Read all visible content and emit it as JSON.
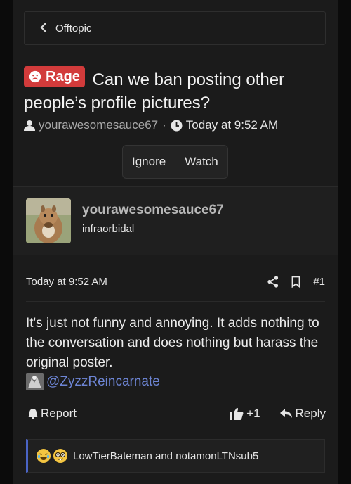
{
  "breadcrumb": {
    "label": "Offtopic"
  },
  "thread": {
    "prefix": "Rage",
    "title": "Can we ban posting other people’s profile pictures?",
    "author": "yourawesomesauce67",
    "separator": "·",
    "time": "Today at 9:52 AM"
  },
  "thread_actions": {
    "ignore": "Ignore",
    "watch": "Watch"
  },
  "post": {
    "username": "yourawesomesauce67",
    "user_title": "infraorbidal",
    "time": "Today at 9:52 AM",
    "number": "#1",
    "body": "It's just not funny and annoying. It adds nothing to the conversation and does nothing but harass the original poster.",
    "mention": "@ZyzzReincarnate",
    "report": "Report",
    "like_count": "+1",
    "reply": "Reply",
    "reactions_text": "LowTierBateman and notamonLTNsub5"
  },
  "colors": {
    "rage_badge": "#d23b3b",
    "mention": "#6d85d4",
    "reaction_accent": "#4a64c5"
  },
  "icons": [
    "chevron-left-icon",
    "frown-icon",
    "user-icon",
    "clock-icon",
    "share-icon",
    "bookmark-icon",
    "alert-icon",
    "thumbs-up-icon",
    "reply-icon",
    "laugh-emoji-icon",
    "nerd-emoji-icon"
  ]
}
